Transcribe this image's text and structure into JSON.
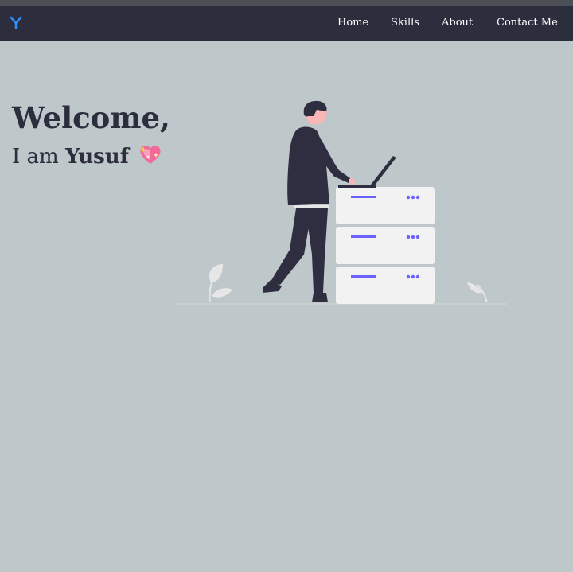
{
  "brand": {
    "logo_icon": "y-logo-icon",
    "logo_color": "#2f8fff"
  },
  "nav": {
    "items": [
      {
        "label": "Home"
      },
      {
        "label": "Skills"
      },
      {
        "label": "About"
      },
      {
        "label": "Contact Me"
      }
    ]
  },
  "hero": {
    "title": "Welcome,",
    "subtitle_prefix": "I am",
    "name": "Yusuf",
    "emoji": "sparkling-heart-icon"
  },
  "colors": {
    "background": "#bec7c9",
    "navbar": "#2c2d3d",
    "text_dark": "#2c2d3d",
    "accent": "#6c63ff"
  }
}
